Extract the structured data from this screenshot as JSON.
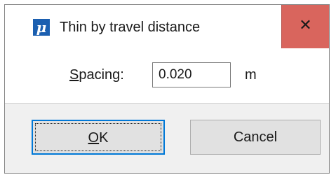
{
  "dialog": {
    "title": "Thin by travel distance",
    "app_icon_glyph": "μ",
    "app_icon_color": "#1b5fb0",
    "close_color": "#d9655d"
  },
  "spacing": {
    "label_accel": "S",
    "label_rest": "pacing:",
    "value": "0.020",
    "unit": "m"
  },
  "buttons": {
    "ok_accel": "O",
    "ok_rest": "K",
    "cancel": "Cancel",
    "focus_color": "#0078d7"
  },
  "icons": {
    "close": "close-icon",
    "app": "app-icon"
  }
}
